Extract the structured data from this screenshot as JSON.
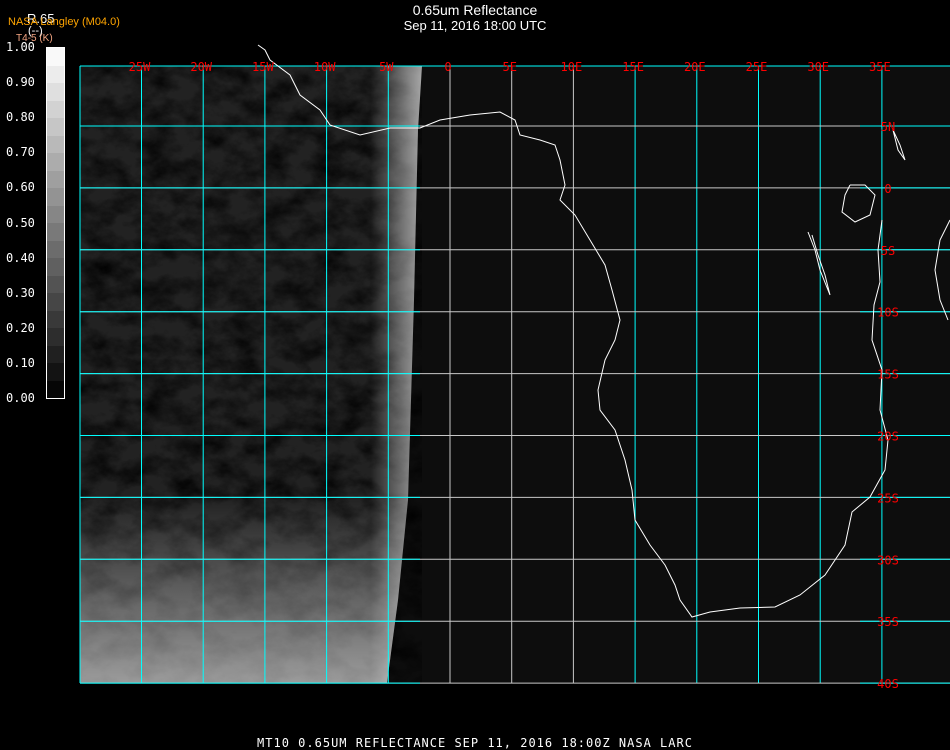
{
  "header": {
    "title": "0.65um Reflectance",
    "subtitle": "Sep 11, 2016 18:00 UTC",
    "source": "NASA Langley (M04.0)"
  },
  "colorbar": {
    "name": "R.65",
    "unit": "(--)",
    "sub": "T4-5 (K)",
    "labels": [
      "1.00",
      "0.90",
      "0.80",
      "0.70",
      "0.60",
      "0.50",
      "0.40",
      "0.30",
      "0.20",
      "0.10",
      "0.00"
    ]
  },
  "map": {
    "lon_labels": [
      "25W",
      "20W",
      "15W",
      "10W",
      "5W",
      "0",
      "5E",
      "10E",
      "15E",
      "20E",
      "25E",
      "30E",
      "35E"
    ],
    "lat_labels": [
      "5N",
      "0",
      "5S",
      "10S",
      "15S",
      "20S",
      "25S",
      "30S",
      "35S",
      "40S"
    ],
    "colors": {
      "grid_cyan": "#00ffff",
      "grid_white": "#c8c8c8",
      "label": "#ff0000",
      "coast": "#ffffff"
    }
  },
  "footer": {
    "text": "MT10  0.65UM REFLECTANCE   SEP 11, 2016 18:00Z   NASA LARC"
  }
}
